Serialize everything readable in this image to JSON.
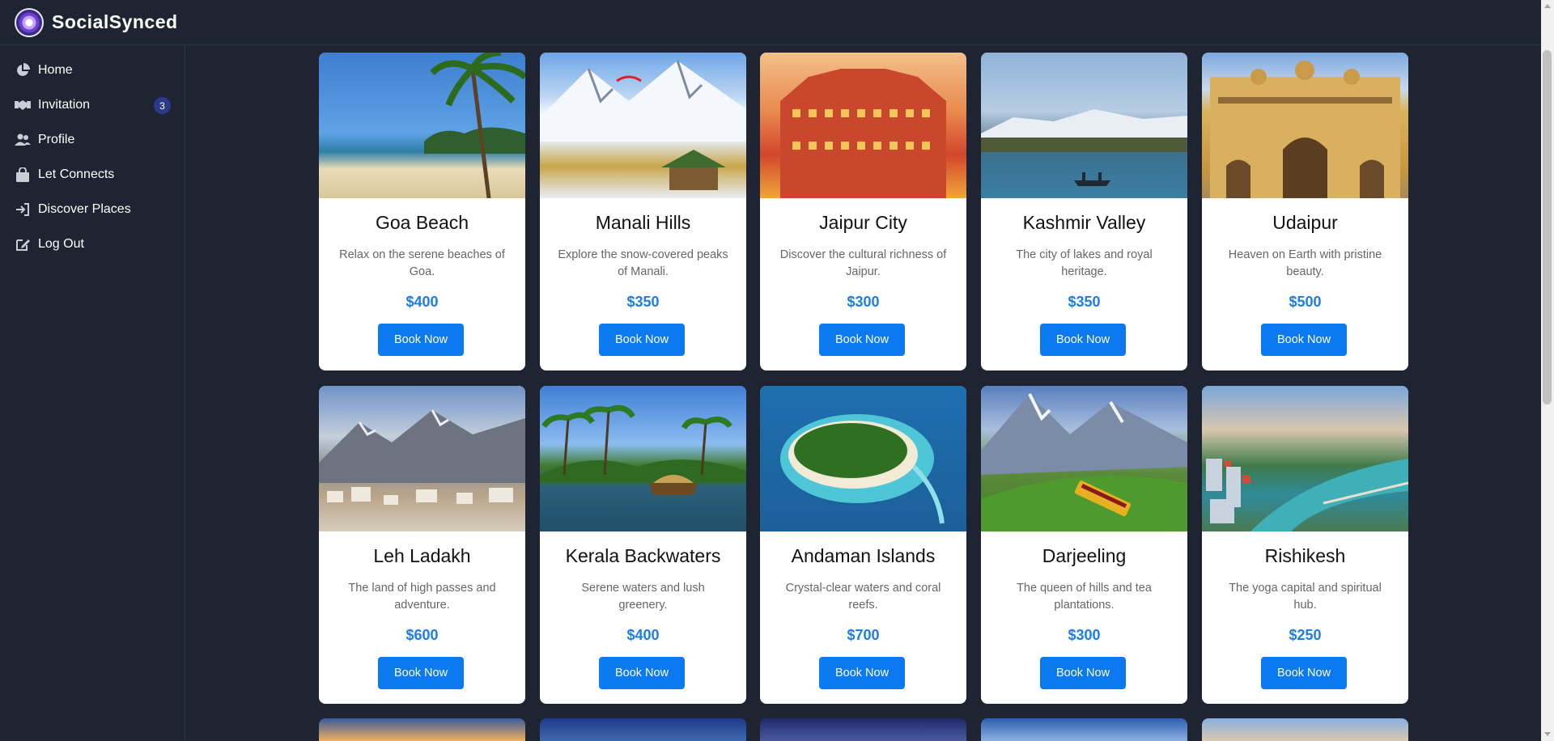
{
  "app": {
    "brand": "SocialSynced"
  },
  "sidebar": {
    "items": [
      {
        "label": "Home",
        "icon": "pie-chart-icon"
      },
      {
        "label": "Invitation",
        "icon": "handshake-icon",
        "badge": "3"
      },
      {
        "label": "Profile",
        "icon": "users-icon"
      },
      {
        "label": "Let Connects",
        "icon": "bag-icon"
      },
      {
        "label": "Discover Places",
        "icon": "sign-in-icon"
      },
      {
        "label": "Log Out",
        "icon": "edit-icon"
      }
    ]
  },
  "cards": [
    {
      "title": "Goa Beach",
      "desc": "Relax on the serene beaches of Goa.",
      "price": "$400",
      "button": "Book Now"
    },
    {
      "title": "Manali Hills",
      "desc": "Explore the snow-covered peaks of Manali.",
      "price": "$350",
      "button": "Book Now"
    },
    {
      "title": "Jaipur City",
      "desc": "Discover the cultural richness of Jaipur.",
      "price": "$300",
      "button": "Book Now"
    },
    {
      "title": "Kashmir Valley",
      "desc": "The city of lakes and royal heritage.",
      "price": "$350",
      "button": "Book Now"
    },
    {
      "title": "Udaipur",
      "desc": "Heaven on Earth with pristine beauty.",
      "price": "$500",
      "button": "Book Now"
    },
    {
      "title": "Leh Ladakh",
      "desc": "The land of high passes and adventure.",
      "price": "$600",
      "button": "Book Now"
    },
    {
      "title": "Kerala Backwaters",
      "desc": "Serene waters and lush greenery.",
      "price": "$400",
      "button": "Book Now"
    },
    {
      "title": "Andaman Islands",
      "desc": "Crystal-clear waters and coral reefs.",
      "price": "$700",
      "button": "Book Now"
    },
    {
      "title": "Darjeeling",
      "desc": "The queen of hills and tea plantations.",
      "price": "$300",
      "button": "Book Now"
    },
    {
      "title": "Rishikesh",
      "desc": "The yoga capital and spiritual hub.",
      "price": "$250",
      "button": "Book Now"
    }
  ],
  "colors": {
    "background": "#1f2432",
    "accent": "#0b79f0",
    "price": "#1c7ce8",
    "badge": "#2b3a8c"
  }
}
